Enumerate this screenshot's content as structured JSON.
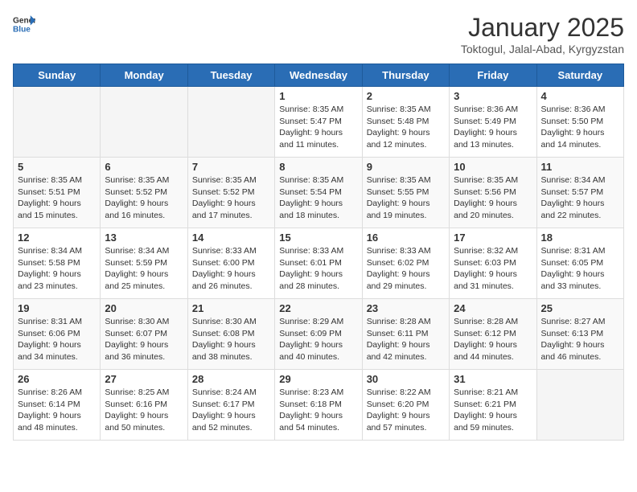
{
  "logo": {
    "general": "General",
    "blue": "Blue"
  },
  "title": "January 2025",
  "subtitle": "Toktogul, Jalal-Abad, Kyrgyzstan",
  "days_header": [
    "Sunday",
    "Monday",
    "Tuesday",
    "Wednesday",
    "Thursday",
    "Friday",
    "Saturday"
  ],
  "weeks": [
    [
      {
        "day": "",
        "info": ""
      },
      {
        "day": "",
        "info": ""
      },
      {
        "day": "",
        "info": ""
      },
      {
        "day": "1",
        "info": "Sunrise: 8:35 AM\nSunset: 5:47 PM\nDaylight: 9 hours\nand 11 minutes."
      },
      {
        "day": "2",
        "info": "Sunrise: 8:35 AM\nSunset: 5:48 PM\nDaylight: 9 hours\nand 12 minutes."
      },
      {
        "day": "3",
        "info": "Sunrise: 8:36 AM\nSunset: 5:49 PM\nDaylight: 9 hours\nand 13 minutes."
      },
      {
        "day": "4",
        "info": "Sunrise: 8:36 AM\nSunset: 5:50 PM\nDaylight: 9 hours\nand 14 minutes."
      }
    ],
    [
      {
        "day": "5",
        "info": "Sunrise: 8:35 AM\nSunset: 5:51 PM\nDaylight: 9 hours\nand 15 minutes."
      },
      {
        "day": "6",
        "info": "Sunrise: 8:35 AM\nSunset: 5:52 PM\nDaylight: 9 hours\nand 16 minutes."
      },
      {
        "day": "7",
        "info": "Sunrise: 8:35 AM\nSunset: 5:52 PM\nDaylight: 9 hours\nand 17 minutes."
      },
      {
        "day": "8",
        "info": "Sunrise: 8:35 AM\nSunset: 5:54 PM\nDaylight: 9 hours\nand 18 minutes."
      },
      {
        "day": "9",
        "info": "Sunrise: 8:35 AM\nSunset: 5:55 PM\nDaylight: 9 hours\nand 19 minutes."
      },
      {
        "day": "10",
        "info": "Sunrise: 8:35 AM\nSunset: 5:56 PM\nDaylight: 9 hours\nand 20 minutes."
      },
      {
        "day": "11",
        "info": "Sunrise: 8:34 AM\nSunset: 5:57 PM\nDaylight: 9 hours\nand 22 minutes."
      }
    ],
    [
      {
        "day": "12",
        "info": "Sunrise: 8:34 AM\nSunset: 5:58 PM\nDaylight: 9 hours\nand 23 minutes."
      },
      {
        "day": "13",
        "info": "Sunrise: 8:34 AM\nSunset: 5:59 PM\nDaylight: 9 hours\nand 25 minutes."
      },
      {
        "day": "14",
        "info": "Sunrise: 8:33 AM\nSunset: 6:00 PM\nDaylight: 9 hours\nand 26 minutes."
      },
      {
        "day": "15",
        "info": "Sunrise: 8:33 AM\nSunset: 6:01 PM\nDaylight: 9 hours\nand 28 minutes."
      },
      {
        "day": "16",
        "info": "Sunrise: 8:33 AM\nSunset: 6:02 PM\nDaylight: 9 hours\nand 29 minutes."
      },
      {
        "day": "17",
        "info": "Sunrise: 8:32 AM\nSunset: 6:03 PM\nDaylight: 9 hours\nand 31 minutes."
      },
      {
        "day": "18",
        "info": "Sunrise: 8:31 AM\nSunset: 6:05 PM\nDaylight: 9 hours\nand 33 minutes."
      }
    ],
    [
      {
        "day": "19",
        "info": "Sunrise: 8:31 AM\nSunset: 6:06 PM\nDaylight: 9 hours\nand 34 minutes."
      },
      {
        "day": "20",
        "info": "Sunrise: 8:30 AM\nSunset: 6:07 PM\nDaylight: 9 hours\nand 36 minutes."
      },
      {
        "day": "21",
        "info": "Sunrise: 8:30 AM\nSunset: 6:08 PM\nDaylight: 9 hours\nand 38 minutes."
      },
      {
        "day": "22",
        "info": "Sunrise: 8:29 AM\nSunset: 6:09 PM\nDaylight: 9 hours\nand 40 minutes."
      },
      {
        "day": "23",
        "info": "Sunrise: 8:28 AM\nSunset: 6:11 PM\nDaylight: 9 hours\nand 42 minutes."
      },
      {
        "day": "24",
        "info": "Sunrise: 8:28 AM\nSunset: 6:12 PM\nDaylight: 9 hours\nand 44 minutes."
      },
      {
        "day": "25",
        "info": "Sunrise: 8:27 AM\nSunset: 6:13 PM\nDaylight: 9 hours\nand 46 minutes."
      }
    ],
    [
      {
        "day": "26",
        "info": "Sunrise: 8:26 AM\nSunset: 6:14 PM\nDaylight: 9 hours\nand 48 minutes."
      },
      {
        "day": "27",
        "info": "Sunrise: 8:25 AM\nSunset: 6:16 PM\nDaylight: 9 hours\nand 50 minutes."
      },
      {
        "day": "28",
        "info": "Sunrise: 8:24 AM\nSunset: 6:17 PM\nDaylight: 9 hours\nand 52 minutes."
      },
      {
        "day": "29",
        "info": "Sunrise: 8:23 AM\nSunset: 6:18 PM\nDaylight: 9 hours\nand 54 minutes."
      },
      {
        "day": "30",
        "info": "Sunrise: 8:22 AM\nSunset: 6:20 PM\nDaylight: 9 hours\nand 57 minutes."
      },
      {
        "day": "31",
        "info": "Sunrise: 8:21 AM\nSunset: 6:21 PM\nDaylight: 9 hours\nand 59 minutes."
      },
      {
        "day": "",
        "info": ""
      }
    ]
  ]
}
